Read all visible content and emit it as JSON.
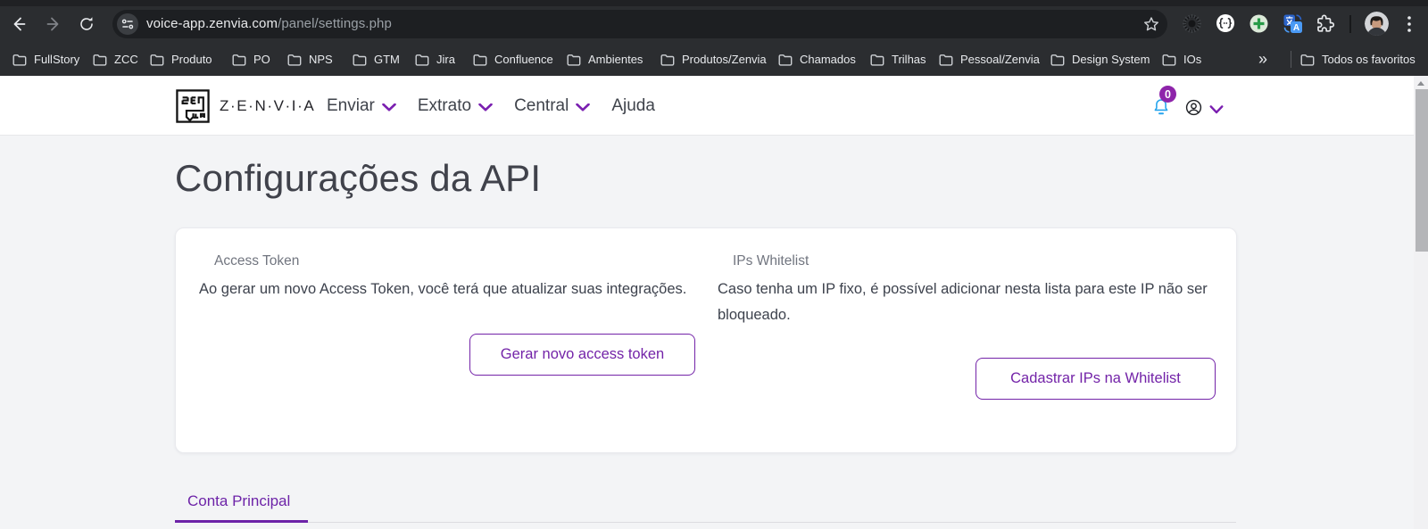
{
  "colors": {
    "accent_purple": "#7323a8",
    "badge_purple": "#8e24aa",
    "bell_blue": "#25a4ed",
    "chrome_dark": "#2b2d30",
    "page_bg": "#f3f4f6"
  },
  "browser": {
    "url": {
      "host": "voice-app.zenvia.com",
      "path": "/panel/settings.php"
    },
    "toolbar_icons": [
      "back",
      "forward",
      "reload",
      "site-settings",
      "bookmark-star",
      "dark-extension",
      "json-extension",
      "add-extension",
      "translate",
      "extensions-puzzle",
      "profile-avatar",
      "menu-dots"
    ],
    "bookmarks": [
      "FullStory",
      "ZCC",
      "Produto",
      "PO",
      "NPS",
      "GTM",
      "Jira",
      "Confluence",
      "Ambientes",
      "Produtos/Zenvia",
      "Chamados",
      "Trilhas",
      "Pessoal/Zenvia",
      "Design System",
      "IOs"
    ],
    "bookmarks_overflow": "»",
    "all_bookmarks_label": "Todos os favoritos"
  },
  "header": {
    "brand": "Z·E·N·V·I·A",
    "nav": [
      {
        "label": "Enviar",
        "dropdown": true
      },
      {
        "label": "Extrato",
        "dropdown": true
      },
      {
        "label": "Central",
        "dropdown": true
      },
      {
        "label": "Ajuda",
        "dropdown": false
      }
    ],
    "notifications_badge": "0"
  },
  "main": {
    "page_title": "Configurações da API",
    "access_token": {
      "label": "Access Token",
      "text": "Ao gerar um novo Access Token, você terá que atualizar suas integrações.",
      "button": "Gerar novo access token"
    },
    "whitelist": {
      "label": "IPs Whitelist",
      "text": "Caso tenha um IP fixo, é possível adicionar nesta lista para este IP não ser bloqueado.",
      "button": "Cadastrar IPs na Whitelist"
    },
    "tabs": [
      {
        "label": "Conta Principal",
        "active": true
      }
    ]
  }
}
